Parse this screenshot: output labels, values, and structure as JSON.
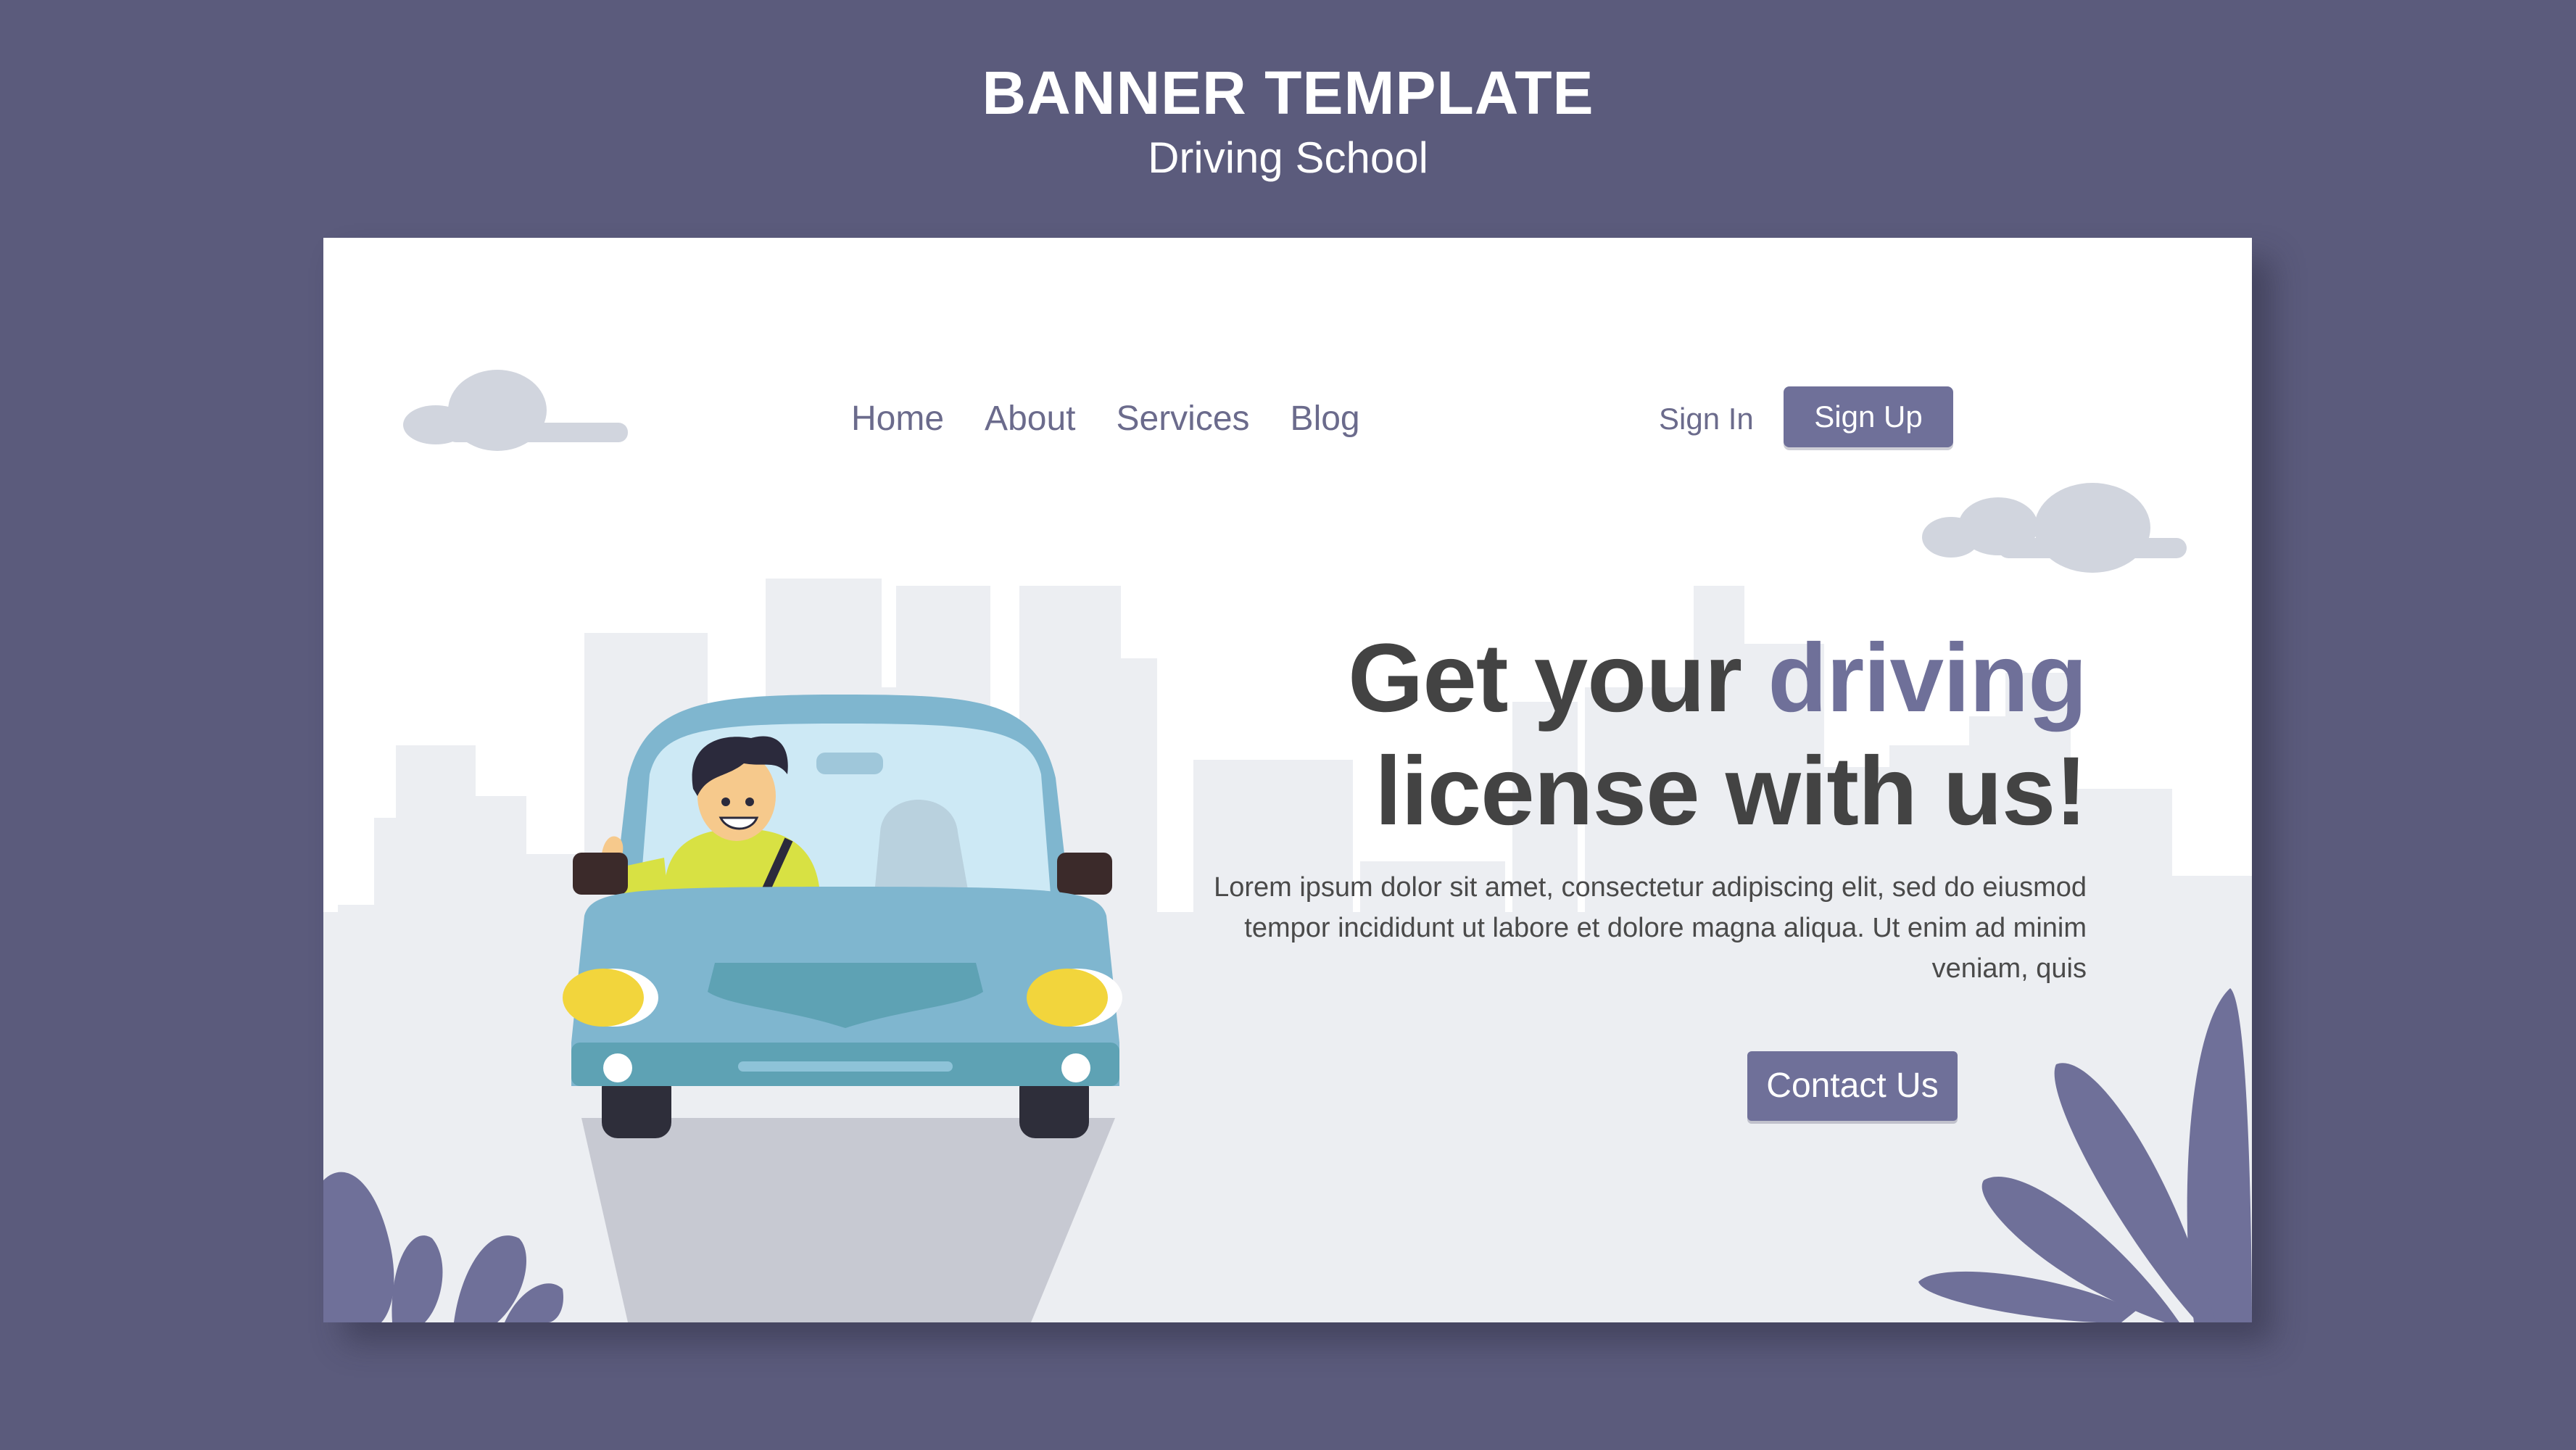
{
  "banner": {
    "title": "BANNER TEMPLATE",
    "subtitle": "Driving School"
  },
  "nav": {
    "links": [
      "Home",
      "About",
      "Services",
      "Blog"
    ],
    "sign_in": "Sign In",
    "sign_up": "Sign Up"
  },
  "hero": {
    "headline_line1_prefix": "Get your ",
    "headline_line1_accent": "driving",
    "headline_line2": "license with us!",
    "body": "Lorem ipsum dolor sit amet, consectetur adipiscing elit, sed do eiusmod tempor incididunt ut labore et dolore magna aliqua. Ut enim ad minim veniam, quis",
    "cta": "Contact Us"
  },
  "colors": {
    "background": "#5b5b7c",
    "accent": "#6f7099",
    "headline": "#434343",
    "car_body": "#7fb6cf",
    "headlight": "#f2d53c"
  },
  "icons": [
    "cloud-icon",
    "car-illustration",
    "driver-illustration",
    "leaf-plant-icon",
    "city-skyline"
  ]
}
